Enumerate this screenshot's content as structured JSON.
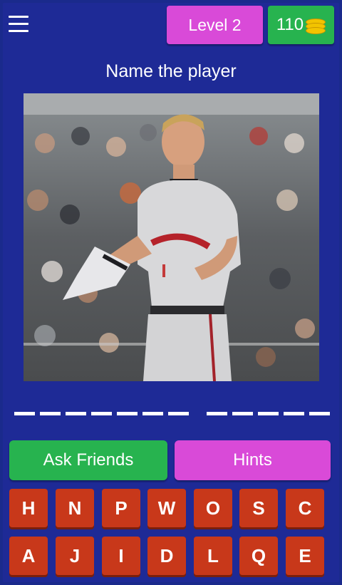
{
  "header": {
    "menu_icon": "hamburger-menu-icon",
    "level_label": "Level 2",
    "coins": "110",
    "coin_icon": "coin-stack-icon"
  },
  "question": {
    "title": "Name the player"
  },
  "photo": {
    "subject": "player-photo"
  },
  "answer": {
    "word_lengths": [
      7,
      5
    ]
  },
  "actions": {
    "ask_label": "Ask Friends",
    "hints_label": "Hints"
  },
  "keyboard": {
    "row1": [
      "H",
      "N",
      "P",
      "W",
      "O",
      "S",
      "C"
    ],
    "row2": [
      "A",
      "J",
      "I",
      "D",
      "L",
      "Q",
      "E"
    ]
  },
  "colors": {
    "background": "#1e2a96",
    "level_button": "#d94ad8",
    "coins_button": "#27b34f",
    "ask_button": "#27b34f",
    "hints_button": "#d94ad8",
    "key": "#c8381a"
  }
}
